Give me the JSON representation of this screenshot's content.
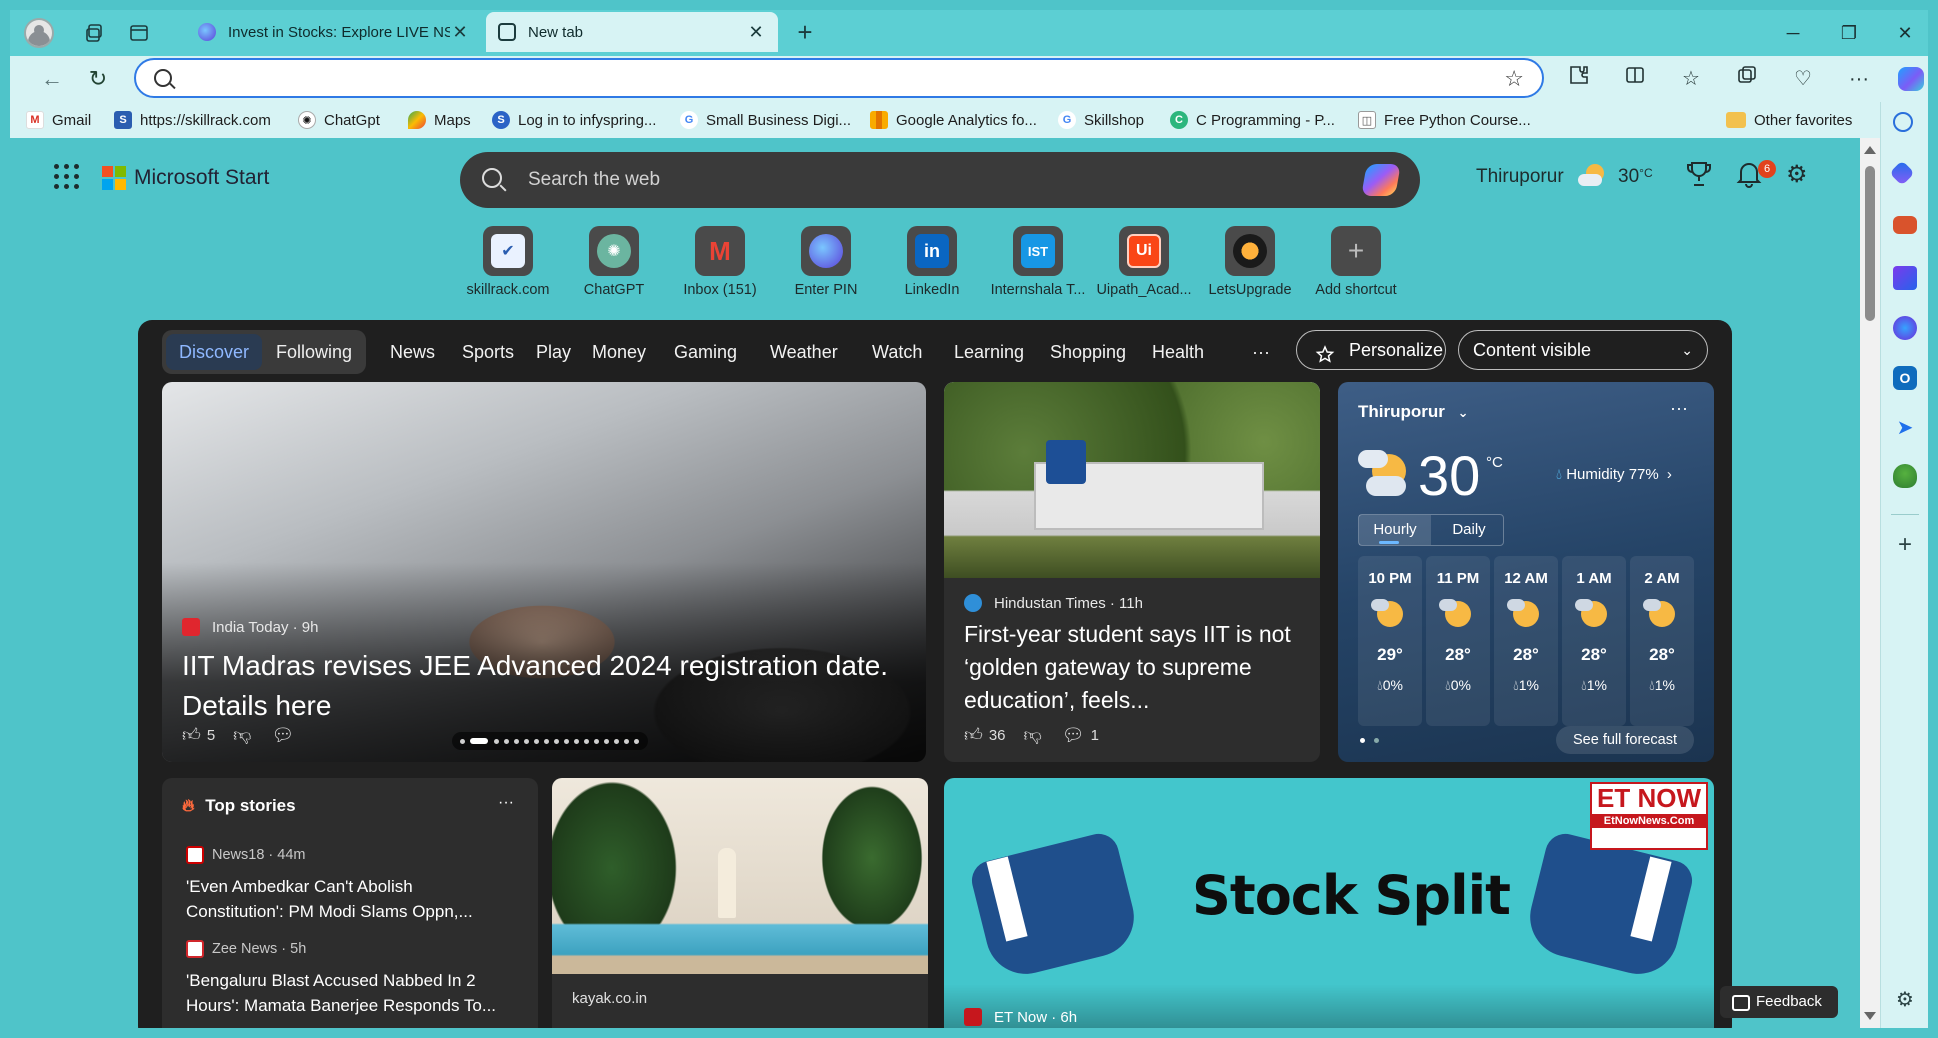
{
  "titlebar": {
    "tabs": [
      {
        "title": "Invest in Stocks: Explore LIVE NSE",
        "active": false
      },
      {
        "title": "New tab",
        "active": true
      }
    ]
  },
  "toolbar": {
    "address_value": "",
    "address_placeholder": ""
  },
  "bookmarks": [
    {
      "label": "Gmail",
      "icon": "gmail-icon"
    },
    {
      "label": "https://skillrack.com",
      "icon": "skillrack-icon"
    },
    {
      "label": "ChatGpt",
      "icon": "chatgpt-icon"
    },
    {
      "label": "Maps",
      "icon": "maps-icon"
    },
    {
      "label": "Log in to infyspring...",
      "icon": "infyspring-icon"
    },
    {
      "label": "Small Business Digi...",
      "icon": "google-icon"
    },
    {
      "label": "Google Analytics fo...",
      "icon": "analytics-icon"
    },
    {
      "label": "Skillshop",
      "icon": "google-icon"
    },
    {
      "label": "C Programming - P...",
      "icon": "c-programming-icon"
    },
    {
      "label": "Free Python Course...",
      "icon": "python-course-icon"
    },
    {
      "label": "Other favorites",
      "icon": "folder-icon"
    }
  ],
  "start": {
    "brand": "Microsoft Start",
    "search_placeholder": "Search the web",
    "location": "Thiruporur",
    "temp": "30",
    "temp_unit": "°C",
    "notifications": "6"
  },
  "shortcuts": [
    {
      "label": "skillrack.com"
    },
    {
      "label": "ChatGPT"
    },
    {
      "label": "Inbox (151)"
    },
    {
      "label": "Enter PIN"
    },
    {
      "label": "LinkedIn"
    },
    {
      "label": "Internshala T..."
    },
    {
      "label": "Uipath_Acad..."
    },
    {
      "label": "LetsUpgrade"
    },
    {
      "label": "Add shortcut"
    }
  ],
  "feed": {
    "discover": "Discover",
    "following": "Following",
    "categories": [
      "News",
      "Sports",
      "Play",
      "Money",
      "Gaming",
      "Weather",
      "Watch",
      "Learning",
      "Shopping",
      "Health"
    ],
    "more": "···",
    "personalize": "Personalize",
    "content_visible": "Content visible"
  },
  "hero": {
    "source": "India Today · 9h",
    "headline": "IIT Madras revises JEE Advanced 2024 registration date. Details here",
    "likes": "5"
  },
  "iit": {
    "source": "Hindustan Times · 11h",
    "headline": "First-year student says IIT is not ‘golden gateway to supreme education’, feels...",
    "likes": "36",
    "comments": "1"
  },
  "weather": {
    "location": "Thiruporur",
    "temp": "30",
    "unit": "°C",
    "humidity": "Humidity 77%",
    "tab_hourly": "Hourly",
    "tab_daily": "Daily",
    "hours": [
      {
        "time": "10 PM",
        "temp": "29°",
        "precip": "0%"
      },
      {
        "time": "11 PM",
        "temp": "28°",
        "precip": "0%"
      },
      {
        "time": "12 AM",
        "temp": "28°",
        "precip": "1%"
      },
      {
        "time": "1 AM",
        "temp": "28°",
        "precip": "1%"
      },
      {
        "time": "2 AM",
        "temp": "28°",
        "precip": "1%"
      }
    ],
    "forecast_link": "See full forecast"
  },
  "top_stories": {
    "title": "Top stories",
    "items": [
      {
        "source": "News18 · 44m",
        "title": "'Even Ambedkar Can't Abolish Constitution': PM Modi Slams Oppn,..."
      },
      {
        "source": "Zee News · 5h",
        "title": "'Bengaluru Blast Accused Nabbed In 2 Hours': Mamata Banerjee Responds To..."
      }
    ]
  },
  "kayak": {
    "source": "kayak.co.in"
  },
  "stock": {
    "image_text": "Stock Split",
    "et_logo": "ET NOW",
    "et_url": "EtNowNews.Com",
    "source": "ET Now · 6h"
  },
  "feedback": "Feedback"
}
